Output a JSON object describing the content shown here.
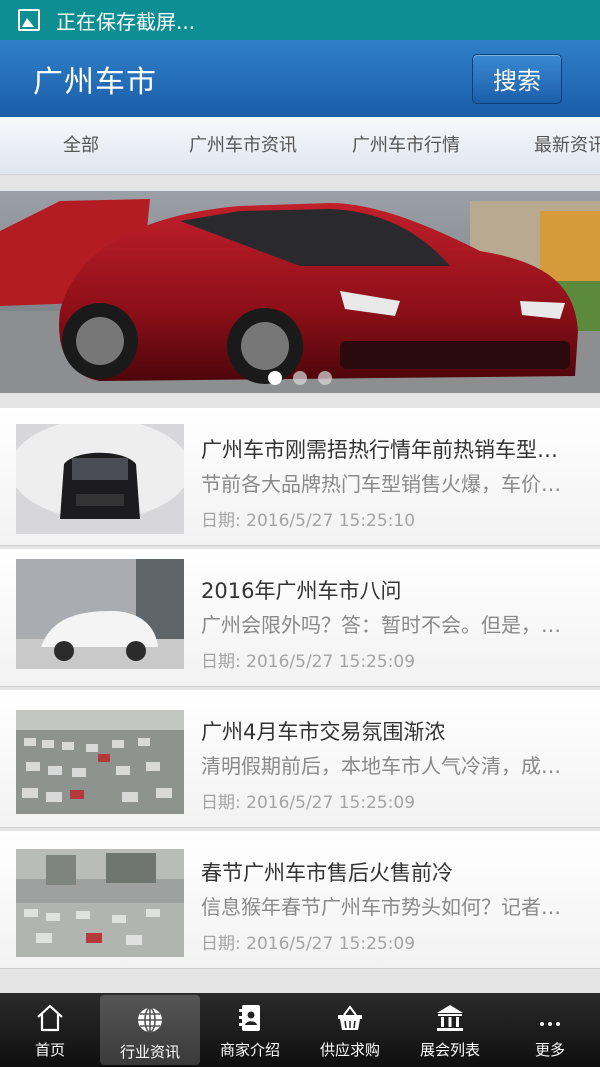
{
  "status_bar": {
    "message": "正在保存截屏..."
  },
  "header": {
    "title": "广州车市",
    "search_label": "搜索"
  },
  "tabs": [
    {
      "label": "全部"
    },
    {
      "label": "广州车市资讯"
    },
    {
      "label": "广州车市行情"
    },
    {
      "label": "最新资讯"
    }
  ],
  "banner": {
    "slides": 3,
    "active_slide": 1
  },
  "news": [
    {
      "title": "广州车市刚需捂热行情年前热销车型…",
      "summary": "节前各大品牌热门车型销售火爆，车价…",
      "date": "日期: 2016/5/27 15:25:10"
    },
    {
      "title": "2016年广州车市八问",
      "summary": "广州会限外吗？答：暂时不会。但是，…",
      "date": "日期: 2016/5/27 15:25:09"
    },
    {
      "title": "广州4月车市交易氛围渐浓",
      "summary": "清明假期前后，本地车市人气冷清，成…",
      "date": "日期: 2016/5/27 15:25:09"
    },
    {
      "title": "春节广州车市售后火售前冷",
      "summary": "信息猴年春节广州车市势头如何？记者…",
      "date": "日期: 2016/5/27 15:25:09"
    }
  ],
  "bottom_nav": [
    {
      "label": "首页",
      "icon": "home-icon"
    },
    {
      "label": "行业资讯",
      "icon": "globe-icon",
      "active": true
    },
    {
      "label": "商家介绍",
      "icon": "contacts-book-icon"
    },
    {
      "label": "供应求购",
      "icon": "basket-icon"
    },
    {
      "label": "展会列表",
      "icon": "building-icon"
    },
    {
      "label": "更多",
      "icon": "more-dots-icon"
    }
  ]
}
